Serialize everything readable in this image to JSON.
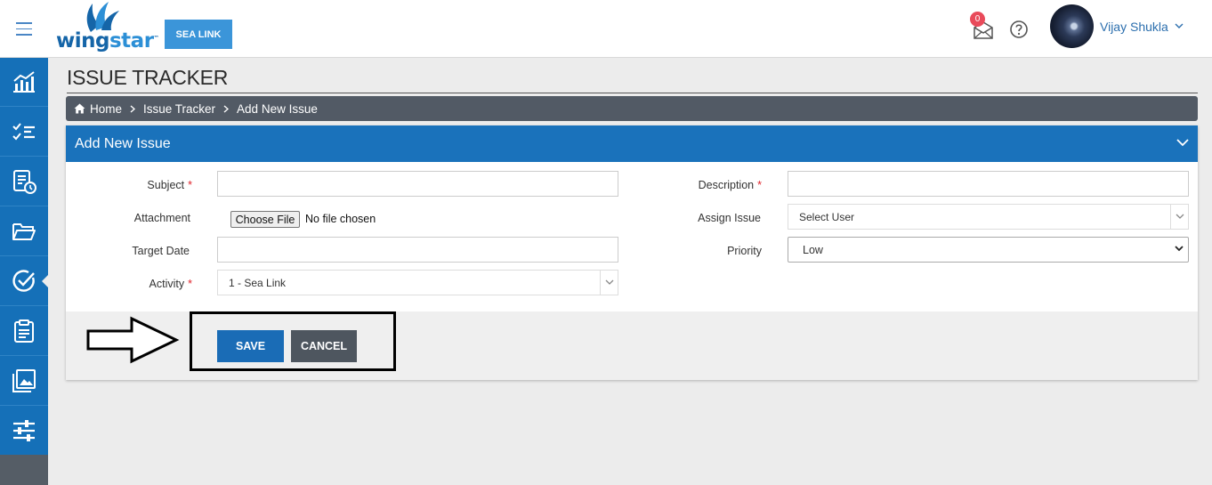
{
  "header": {
    "logo_text_1": "wing",
    "logo_text_2": "star",
    "logo_tm": "™",
    "project_button": "SEA LINK",
    "mail_count": "0",
    "user_name": "Vijay Shukla",
    "brand_color": "#1570b8"
  },
  "sidebar": {
    "items": [
      {
        "icon": "chart-icon"
      },
      {
        "icon": "checklist-icon"
      },
      {
        "icon": "report-clock-icon"
      },
      {
        "icon": "folder-open-icon"
      },
      {
        "icon": "check-circle-icon",
        "active": true
      },
      {
        "icon": "clipboard-icon"
      },
      {
        "icon": "gallery-icon"
      },
      {
        "icon": "sliders-icon"
      }
    ]
  },
  "page": {
    "title": "ISSUE TRACKER",
    "breadcrumb": [
      "Home",
      "Issue Tracker",
      "Add New Issue"
    ]
  },
  "form": {
    "panel_title": "Add New Issue",
    "subject_label": "Subject",
    "attachment_label": "Attachment",
    "target_date_label": "Target Date",
    "activity_label": "Activity",
    "description_label": "Description",
    "assign_issue_label": "Assign Issue",
    "priority_label": "Priority",
    "required_mark": "*",
    "subject_value": "",
    "target_date_value": "",
    "description_value": "",
    "file_button": "Choose File",
    "file_status": "No file chosen",
    "activity_value": "1 - Sea Link",
    "assign_value": "Select User",
    "priority_value": "Low",
    "save_label": "SAVE",
    "cancel_label": "CANCEL"
  }
}
